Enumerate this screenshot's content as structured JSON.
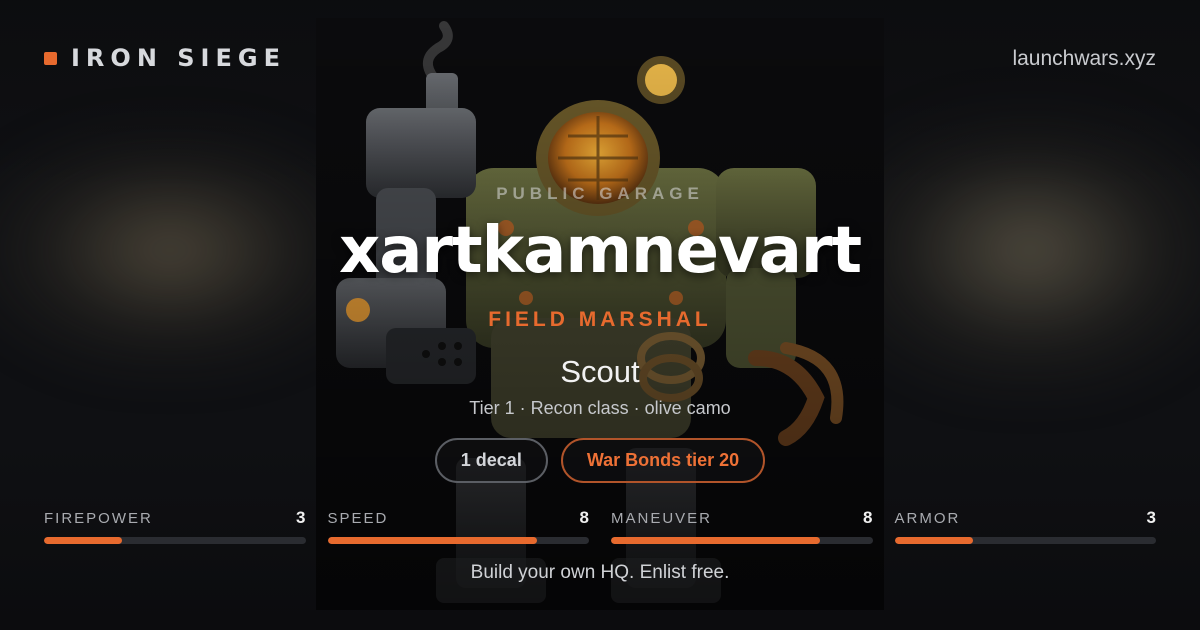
{
  "brand": {
    "name": "IRON SIEGE",
    "icon": "orange-square"
  },
  "site_url": "launchwars.xyz",
  "profile": {
    "eyebrow": "PUBLIC GARAGE",
    "username": "xartkamnevart",
    "rank": "FIELD MARSHAL"
  },
  "mech": {
    "name": "Scout",
    "subtitle": "Tier 1 · Recon class · olive camo"
  },
  "chips": [
    {
      "label": "1 decal"
    },
    {
      "label": "War Bonds tier 20"
    }
  ],
  "stats": [
    {
      "label": "FIREPOWER",
      "value": "3",
      "fraction": 0.3
    },
    {
      "label": "SPEED",
      "value": "8",
      "fraction": 0.8
    },
    {
      "label": "MANEUVER",
      "value": "8",
      "fraction": 0.8
    },
    {
      "label": "ARMOR",
      "value": "3",
      "fraction": 0.3
    }
  ],
  "footer": "Build your own HQ. Enlist free.",
  "colors": {
    "accent": "#e76a2e",
    "background": "#0f1013",
    "olive": "#4f5331"
  }
}
